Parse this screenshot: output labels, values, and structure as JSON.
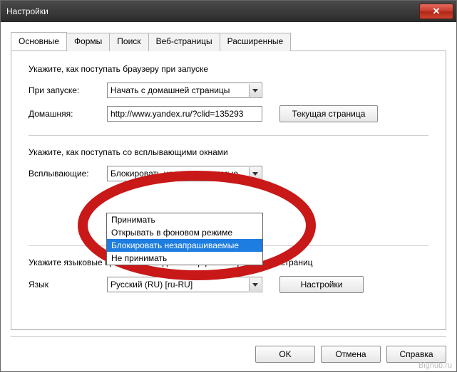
{
  "window": {
    "title": "Настройки"
  },
  "tabs": [
    {
      "label": "Основные"
    },
    {
      "label": "Формы"
    },
    {
      "label": "Поиск"
    },
    {
      "label": "Веб-страницы"
    },
    {
      "label": "Расширенные"
    }
  ],
  "section_startup": {
    "heading": "Укажите, как поступать браузеру при запуске",
    "on_start_label": "При запуске:",
    "on_start_value": "Начать с домашней страницы",
    "home_label": "Домашняя:",
    "home_value": "http://www.yandex.ru/?clid=135293",
    "current_page_btn": "Текущая страница"
  },
  "section_popups": {
    "heading": "Укажите, как поступать со всплывающими окнами",
    "popups_label": "Всплывающие:",
    "popups_value": "Блокировать незапрашиваемые",
    "options": [
      "Принимать",
      "Открывать в фоновом режиме",
      "Блокировать незапрашиваемые",
      "Не принимать"
    ],
    "highlighted_index": 2
  },
  "section_language": {
    "heading": "Укажите языковые предпочтения для интерфейса Opera и веб-страниц",
    "language_label": "Язык",
    "language_value": "Русский (RU) [ru-RU]",
    "settings_btn": "Настройки"
  },
  "buttons": {
    "ok": "OK",
    "cancel": "Отмена",
    "help": "Справка"
  },
  "watermark": "Bighub.ru"
}
